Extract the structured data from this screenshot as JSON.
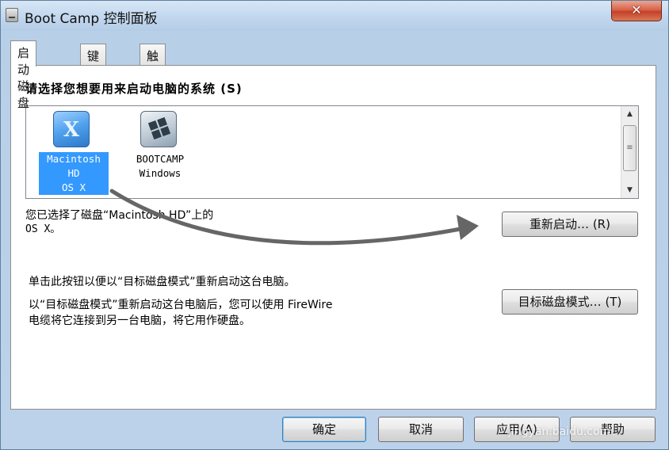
{
  "window": {
    "title": "Boot Camp 控制面板",
    "close_glyph": "✕"
  },
  "tabs": [
    {
      "label": "启动磁盘",
      "active": true
    },
    {
      "label": "键盘",
      "active": false
    },
    {
      "label": "触控板",
      "active": false
    }
  ],
  "startup": {
    "heading": "请选择您想要用来启动电脑的系统 (S)",
    "disks": [
      {
        "label": "Macintosh\nHD\nOS X",
        "icon": "osx-disk-icon",
        "icon_glyph": "X",
        "selected": true
      },
      {
        "label": "BOOTCAMP\nWindows",
        "icon": "windows-disk-icon",
        "selected": false
      }
    ],
    "selected_line1": "您已选择了磁盘“Macintosh HD”上的",
    "selected_line2": "OS X。",
    "restart_button": "重新启动… (R)"
  },
  "target_mode": {
    "line1": "单击此按钮以便以“目标磁盘模式”重新启动这台电脑。",
    "line2": "以“目标磁盘模式”重新启动这台电脑后，您可以使用 FireWire",
    "line3": "电缆将它连接到另一台电脑，将它用作硬盘。",
    "button": "目标磁盘模式… (T)"
  },
  "footer": {
    "ok": "确定",
    "cancel": "取消",
    "apply": "应用(A)",
    "help": "帮助"
  },
  "watermark": "jingyan.baidu.com",
  "annotation_arrow_color": "#666666"
}
